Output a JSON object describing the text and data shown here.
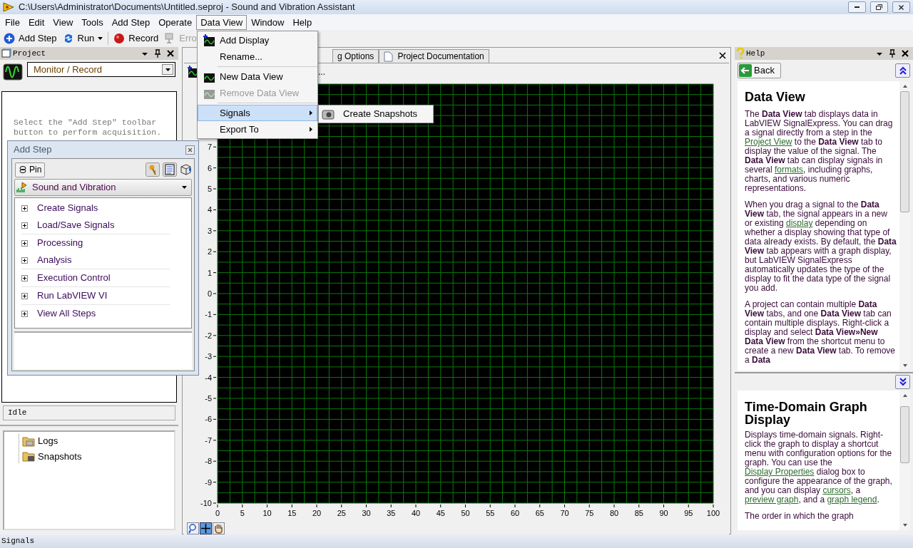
{
  "window": {
    "title": "C:\\Users\\Administrator\\Documents\\Untitled.seproj - Sound and Vibration Assistant"
  },
  "menu_bar": [
    {
      "label": "File",
      "open": false
    },
    {
      "label": "Edit",
      "open": false
    },
    {
      "label": "View",
      "open": false
    },
    {
      "label": "Tools",
      "open": false
    },
    {
      "label": "Add Step",
      "open": false
    },
    {
      "label": "Operate",
      "open": false
    },
    {
      "label": "Data View",
      "open": true
    },
    {
      "label": "Window",
      "open": false
    },
    {
      "label": "Help",
      "open": false
    }
  ],
  "toolbar": [
    {
      "kind": "add",
      "label": "Add Step",
      "has_dropdown": false,
      "disabled": false
    },
    {
      "kind": "run",
      "label": "Run",
      "has_dropdown": true,
      "disabled": false
    },
    {
      "kind": "record",
      "label": "Record",
      "has_dropdown": false,
      "disabled": false
    },
    {
      "kind": "errors",
      "label": "Erro",
      "has_dropdown": false,
      "disabled": true
    }
  ],
  "project_panel": {
    "title": "Project",
    "mode": "Monitor / Record",
    "message": "Select the ″Add Step″ toolbar button to perform acquisition.",
    "status": "Idle",
    "tree": [
      {
        "label": "Logs",
        "kind": "logs"
      },
      {
        "label": "Snapshots",
        "kind": "snapshots"
      }
    ]
  },
  "center": {
    "tabs": [
      {
        "label": "g Options",
        "selected": false
      },
      {
        "label": "Project Documentation",
        "selected": false
      }
    ],
    "toolbar_text": "...",
    "chart_data": {
      "type": "line",
      "xlim": [
        0,
        100
      ],
      "ylim": [
        -10,
        10
      ],
      "xticks": [
        0,
        5,
        10,
        15,
        20,
        25,
        30,
        35,
        40,
        45,
        50,
        55,
        60,
        65,
        70,
        75,
        80,
        85,
        90,
        95,
        100
      ],
      "yticks": [
        7,
        6,
        5,
        4,
        3,
        2,
        1,
        0,
        -1,
        -2,
        -3,
        -4,
        -5,
        -6,
        -7,
        -8,
        -9,
        -10
      ],
      "grid": true
    }
  },
  "add_step_panel": {
    "title": "Add Step",
    "pin": "Pin",
    "category": "Sound and Vibration",
    "groups": [
      {
        "items": [
          {
            "label": "Create Signals",
            "expanded": false
          },
          {
            "label": "Load/Save Signals",
            "expanded": false
          }
        ]
      },
      {
        "items": [
          {
            "label": "Processing",
            "expanded": false
          },
          {
            "label": "Analysis",
            "expanded": false
          }
        ]
      },
      {
        "items": [
          {
            "label": "Execution Control",
            "expanded": false
          }
        ]
      },
      {
        "items": [
          {
            "label": "Run LabVIEW VI",
            "expanded": false
          }
        ]
      },
      {
        "items": [
          {
            "label": "View All Steps",
            "expanded": false
          }
        ]
      }
    ]
  },
  "data_view_menu": [
    {
      "kind": "command",
      "label": "Add Display",
      "disabled": false,
      "selected": false
    },
    {
      "kind": "command",
      "label": "Rename...",
      "disabled": false,
      "selected": false
    },
    {
      "kind": "separator"
    },
    {
      "kind": "command",
      "label": "New Data View",
      "disabled": false,
      "selected": false
    },
    {
      "kind": "command",
      "label": "Remove Data View",
      "disabled": true,
      "selected": false
    },
    {
      "kind": "separator"
    },
    {
      "kind": "submenu",
      "label": "Signals",
      "disabled": false,
      "selected": true
    },
    {
      "kind": "submenu",
      "label": "Export To",
      "disabled": false,
      "selected": false
    }
  ],
  "signals_submenu": [
    {
      "label": "Create Snapshots"
    }
  ],
  "help_panel": {
    "title": "Help",
    "back": "Back",
    "top": {
      "heading": "Data View",
      "paragraphs": [
        [
          {
            "text": "The **Data View** tab displays data in LabVIEW SignalExpress. You can drag a signal directly from a step in the ",
            "link": false
          },
          {
            "text": "Project View",
            "link": true
          },
          {
            "text": " to the **Data View** tab to display the value of the signal. The **Data View** tab can display signals in several ",
            "link": false
          },
          {
            "text": "formats",
            "link": true
          },
          {
            "text": ", including graphs, charts, and various numeric representations.",
            "link": false
          }
        ],
        [
          {
            "text": "When you drag a signal to the **Data View** tab, the signal appears in a new or existing ",
            "link": false
          },
          {
            "text": "display",
            "link": true
          },
          {
            "text": " depending on whether a display showing that type of data already exists. By default, the **Data View** tab appears with a graph display, but LabVIEW SignalExpress automatically updates the type of the display to fit the data type of the signal you add.",
            "link": false
          }
        ],
        [
          {
            "text": "A project can contain multiple **Data View** tabs, and one **Data View** tab can contain multiple displays. Right-click a display and select **Data View»New Data View** from the shortcut menu to create a new **Data View** tab. To remove a **Data**",
            "link": false
          }
        ]
      ]
    },
    "bottom": {
      "heading": "Time-Domain Graph Display",
      "paragraphs": [
        [
          {
            "text": "Displays time-domain signals. Right-click the graph to display a shortcut menu with configuration options for the graph. You can use the ",
            "link": false
          },
          {
            "text": "Display Properties",
            "link": true
          },
          {
            "text": " dialog box to configure the appearance of the graph, and you can display ",
            "link": false
          },
          {
            "text": "cursors",
            "link": true
          },
          {
            "text": ", a ",
            "link": false
          },
          {
            "text": "preview graph",
            "link": true
          },
          {
            "text": ", and a ",
            "link": false
          },
          {
            "text": "graph legend",
            "link": true
          },
          {
            "text": ".",
            "link": false
          }
        ],
        [
          {
            "text": "The order in which the graph",
            "link": false
          }
        ]
      ]
    }
  },
  "status_bar": {
    "text": "Signals"
  }
}
